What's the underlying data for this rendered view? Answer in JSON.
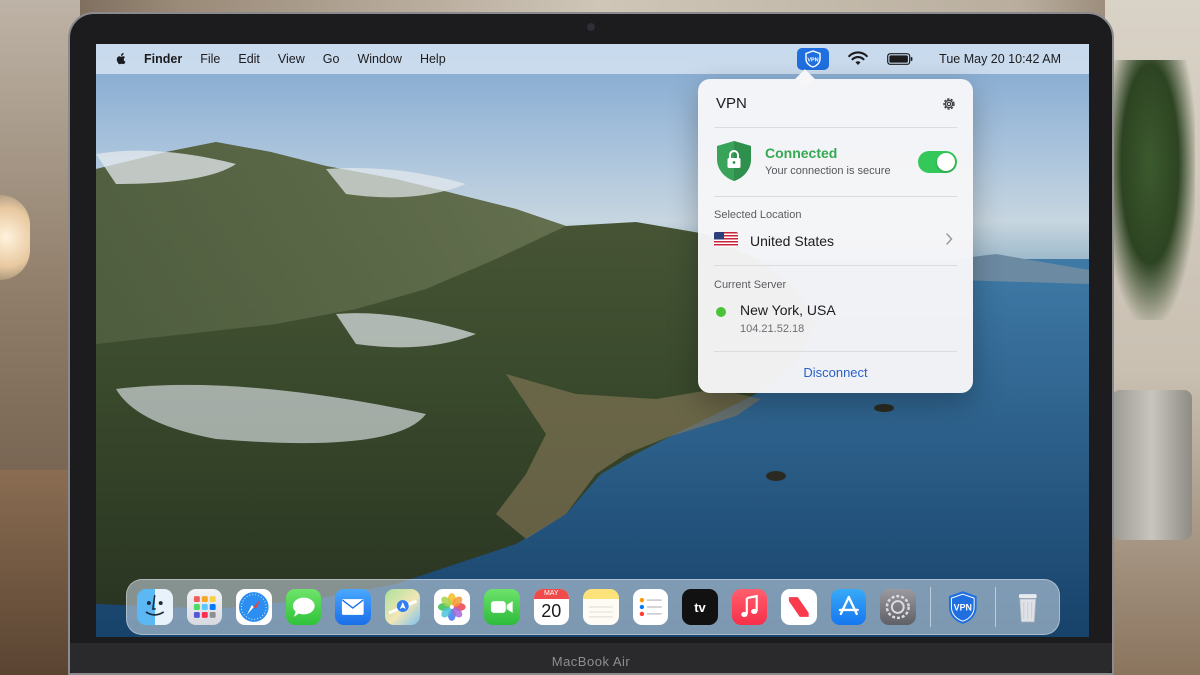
{
  "device": {
    "label": "MacBook Air"
  },
  "menubar": {
    "app_name": "Finder",
    "menus": [
      "File",
      "Edit",
      "View",
      "Go",
      "Window",
      "Help"
    ],
    "status_vpn_label": "VPN",
    "clock": "Tue May 20  10:42 AM"
  },
  "vpn_panel": {
    "title": "VPN",
    "status_title": "Connected",
    "status_subtitle": "Your connection is secure",
    "toggle_on": true,
    "selected_location_label": "Selected Location",
    "location_name": "United States",
    "current_server_label": "Current Server",
    "server_name": "New York, USA",
    "server_ip": "104.21.52.18",
    "disconnect_label": "Disconnect",
    "status_color": "#34a853",
    "accent_color": "#2a5fc8"
  },
  "dock": {
    "items": [
      {
        "name": "finder-icon"
      },
      {
        "name": "launchpad-icon"
      },
      {
        "name": "safari-icon"
      },
      {
        "name": "messages-icon"
      },
      {
        "name": "mail-icon"
      },
      {
        "name": "maps-icon"
      },
      {
        "name": "photos-icon"
      },
      {
        "name": "facetime-icon"
      },
      {
        "name": "calendar-icon"
      },
      {
        "name": "notes-icon"
      },
      {
        "name": "reminders-icon"
      },
      {
        "name": "apple-tv-icon"
      },
      {
        "name": "music-icon"
      },
      {
        "name": "news-icon"
      },
      {
        "name": "app-store-icon"
      },
      {
        "name": "system-settings-icon"
      },
      {
        "name": "vpn-app-icon"
      },
      {
        "name": "trash-icon"
      }
    ],
    "calendar_month": "MAY",
    "calendar_day": "20",
    "tv_label": "tv",
    "vpn_label": "VPN"
  }
}
